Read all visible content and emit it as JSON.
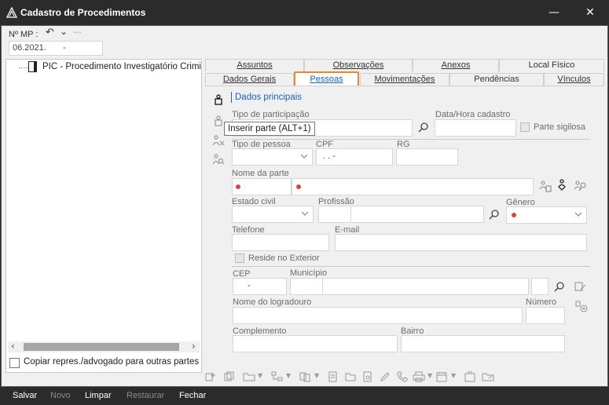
{
  "window": {
    "title": "Cadastro de Procedimentos",
    "minimize_glyph": "—",
    "close_glyph": "✕"
  },
  "header": {
    "nmp_label": "Nº MP :",
    "nmp_value_left": "06.2021.",
    "nmp_value_right": "-",
    "undo_glyph": "↶",
    "dropdown_glyph": "⌄",
    "more_glyph": "···"
  },
  "tree": {
    "items": [
      {
        "label": "PIC - Procedimento Investigatório Crimi"
      }
    ],
    "scroll_left": "‹",
    "scroll_right": "›"
  },
  "copy_checkbox": {
    "label": "Copiar repres./advogado para outras partes"
  },
  "tabs_row1": [
    "Assuntos",
    "Observações",
    "Anexos",
    "Local Físico"
  ],
  "tabs_row2": [
    "Dados Gerais",
    "Pessoas",
    "Movimentações",
    "Pendências",
    "Vínculos"
  ],
  "active_tab": "Pessoas",
  "section": {
    "title": "Dados principais"
  },
  "tooltip": "Inserir parte (ALT+1)",
  "form": {
    "tipo_participacao_label": "Tipo de participação",
    "data_hora_label": "Data/Hora cadastro",
    "parte_sigilosa_label": "Parte sigilosa",
    "tipo_pessoa_label": "Tipo de pessoa",
    "cpf_label": "CPF",
    "cpf_value": ".   .   -",
    "rg_label": "RG",
    "nome_parte_label": "Nome da parte",
    "estado_civil_label": "Estado civil",
    "profissao_label": "Profissão",
    "genero_label": "Gênero",
    "telefone_label": "Telefone",
    "email_label": "E-mail",
    "reside_exterior_label": "Reside no Exterior",
    "cep_label": "CEP",
    "cep_value": "-",
    "municipio_label": "Município",
    "logradouro_label": "Nome do logradouro",
    "numero_label": "Número",
    "complemento_label": "Complemento",
    "bairro_label": "Bairro"
  },
  "footer": {
    "salvar": "Salvar",
    "novo": "Novo",
    "limpar": "Limpar",
    "restaurar": "Restaurar",
    "fechar": "Fechar"
  },
  "colors": {
    "active_tab_outline": "#e8892b",
    "link_blue": "#1f5fbf",
    "required_dot": "#e04040"
  }
}
